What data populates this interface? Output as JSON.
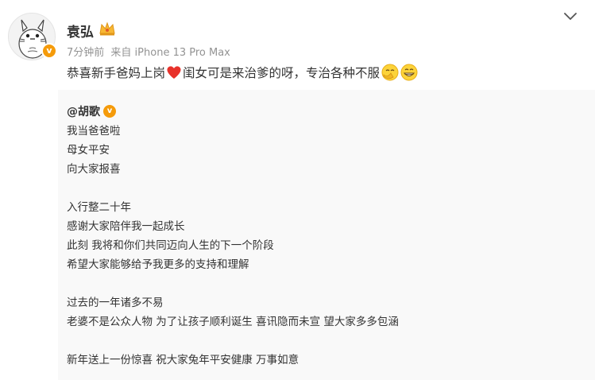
{
  "post": {
    "username": "袁弘",
    "time": "7分钟前",
    "source": "来自 iPhone 13 Pro Max",
    "text_main": "恭喜新手爸妈上岗",
    "text_after_heart": "闺女可是来治爹的呀，专治各种不服",
    "verified_mark": "v"
  },
  "repost": {
    "mention": "@胡歌",
    "verified_mark": "v",
    "lines": [
      "我当爸爸啦",
      "母女平安",
      "向大家报喜",
      "入行整二十年",
      "感谢大家陪伴我一起成长",
      "此刻 我将和你们共同迈向人生的下一个阶段",
      "希望大家能够给予我更多的支持和理解",
      "过去的一年诸多不易",
      "老婆不是公众人物 为了让孩子顺利诞生 喜讯隐而未宣 望大家多多包涵",
      "新年送上一份惊喜 祝大家兔年平安健康 万事如意"
    ]
  },
  "icons": {
    "menu": "chevron-down-icon",
    "crown": "crown-icon",
    "heart": "red-heart-emoji",
    "emoji1": "hiding-smile-emoji",
    "emoji2": "grin-emoji"
  },
  "colors": {
    "verified": "#f59b0a",
    "heart": "#e8322b",
    "meta": "#939393",
    "repost_bg": "#f9f9f9"
  }
}
